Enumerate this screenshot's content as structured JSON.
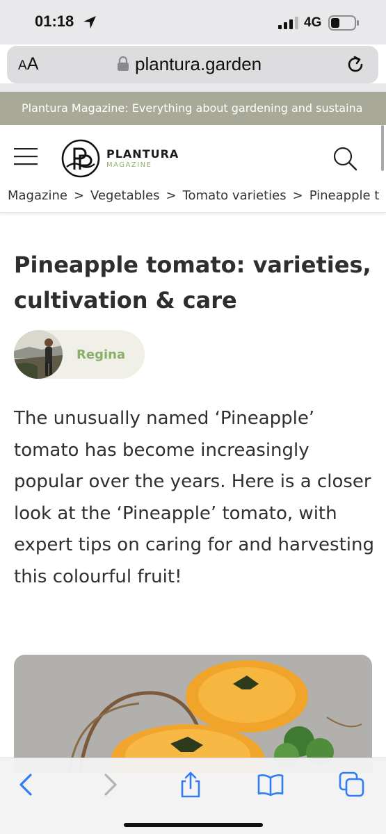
{
  "status_bar": {
    "time": "01:18",
    "network": "4G",
    "icons": [
      "location-arrow-icon",
      "signal-bars-icon",
      "battery-icon"
    ]
  },
  "browser": {
    "text_size_label_small": "A",
    "text_size_label_big": "A",
    "url": "plantura.garden",
    "icons": [
      "lock-icon",
      "reload-icon"
    ]
  },
  "announcement": {
    "text": "Plantura Magazine: Everything about gardening and sustaina"
  },
  "header": {
    "logo_title": "PLANTURA",
    "logo_subtitle": "MAGAZINE",
    "icons": [
      "menu-icon",
      "logo-icon",
      "search-icon"
    ]
  },
  "breadcrumb": {
    "items": [
      "Magazine",
      "Vegetables",
      "Tomato varieties",
      "Pineapple t"
    ],
    "separator": ">"
  },
  "article": {
    "title": "Pineapple tomato: varieties, cultivation & care",
    "author": "Regina",
    "intro": "The unusually named ‘Pineapple’ tomato has become increasingly popular over the years. Here is a closer look at the ‘Pineapple’ tomato, with expert tips on caring for and harvesting this colourful fruit!"
  },
  "bottom_toolbar": {
    "icons": [
      "back-icon",
      "forward-icon",
      "share-icon",
      "bookmarks-icon",
      "tabs-icon"
    ]
  },
  "colors": {
    "announcement_bg": "#a8a996",
    "accent_green": "#8ab06a",
    "ios_blue": "#2f7cf6",
    "author_pill_bg": "#f0efe8"
  }
}
